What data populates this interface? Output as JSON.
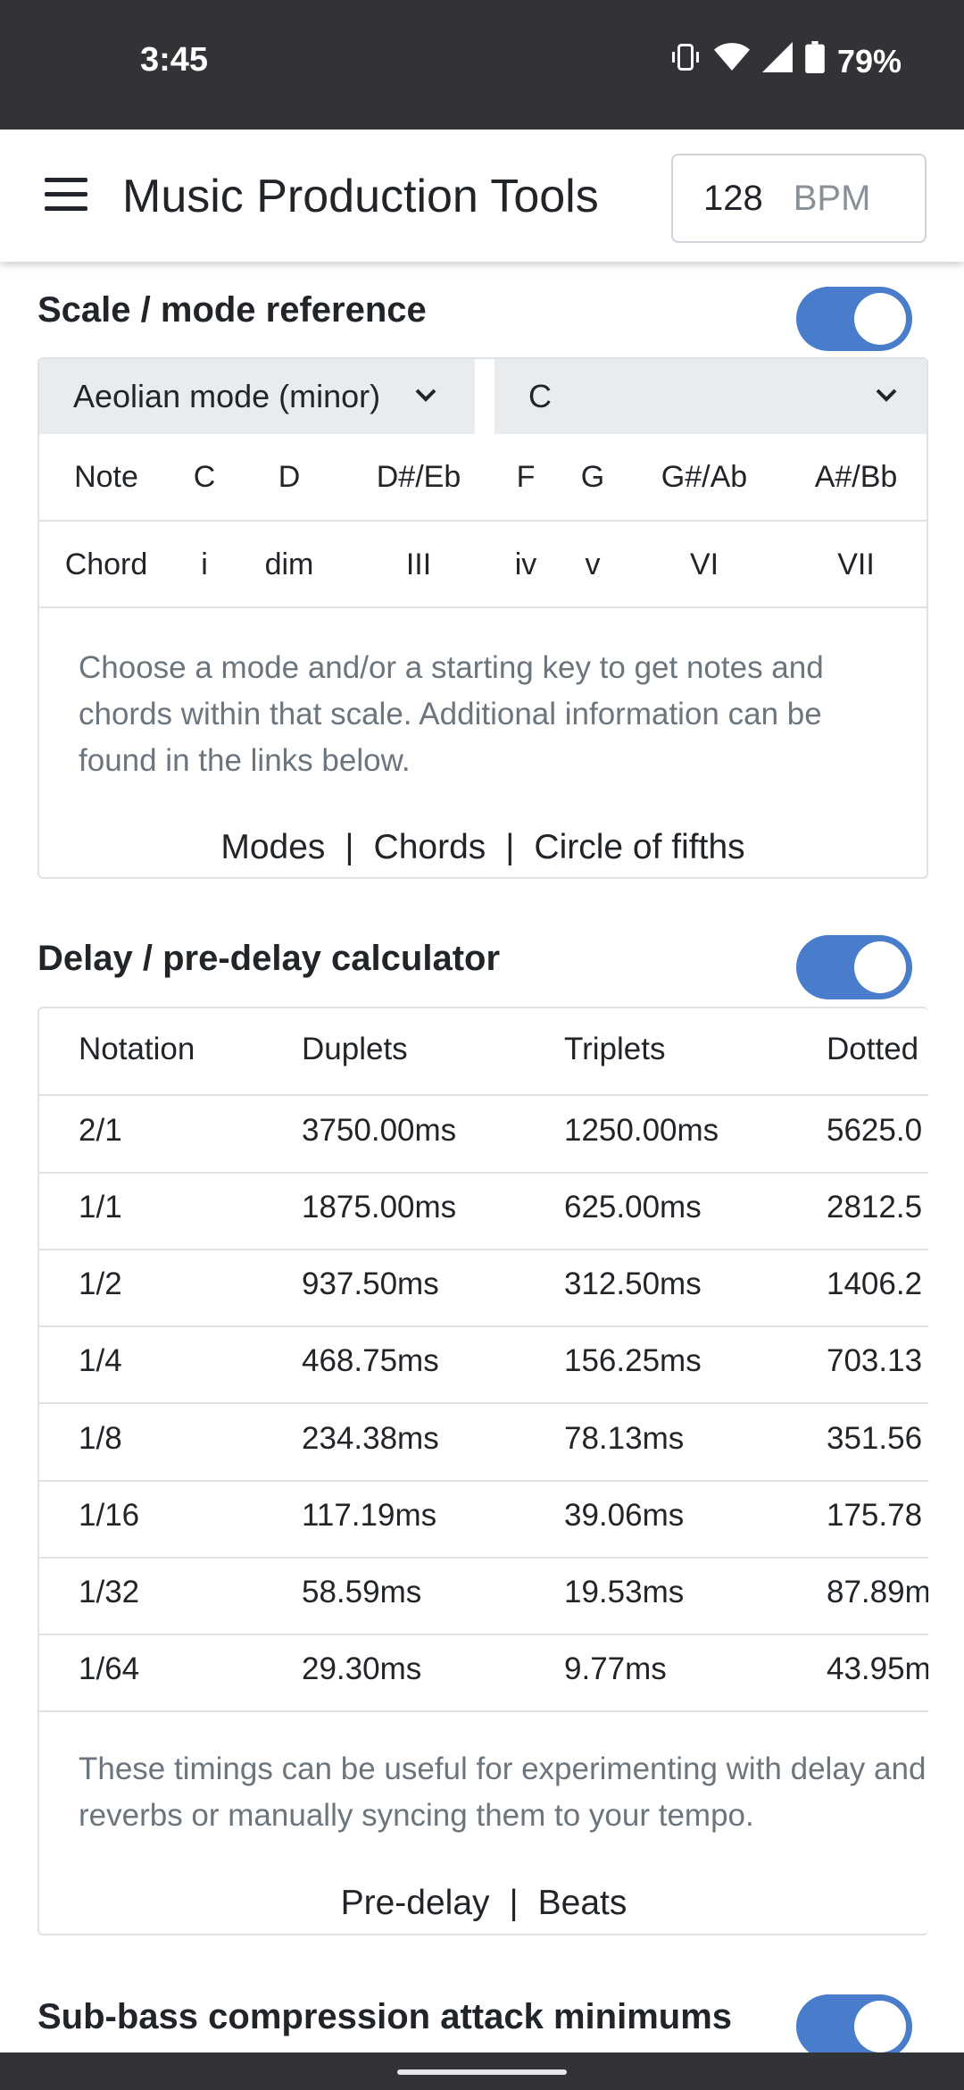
{
  "status_bar": {
    "time": "3:45",
    "battery": "79%"
  },
  "app_bar": {
    "title": "Music Production Tools",
    "bpm_value": "128",
    "bpm_unit": "BPM"
  },
  "scale_section": {
    "title": "Scale / mode reference",
    "toggle_on": true,
    "mode_select": "Aeolian mode (minor)",
    "key_select": "C",
    "notes": [
      "Note",
      "C",
      "D",
      "D#/Eb",
      "F",
      "G",
      "G#/Ab",
      "A#/Bb"
    ],
    "chords": [
      "Chord",
      "i",
      "dim",
      "III",
      "iv",
      "v",
      "VI",
      "VII"
    ],
    "description": "Choose a mode and/or a starting key to get notes and chords within that scale. Additional information can be found in the links below.",
    "links": [
      "Modes",
      "Chords",
      "Circle of fifths"
    ],
    "separator": "|"
  },
  "delay_section": {
    "title": "Delay / pre-delay calculator",
    "toggle_on": true,
    "headers": [
      "Notation",
      "Duplets",
      "Triplets",
      "Dotted"
    ],
    "rows": [
      [
        "2/1",
        "3750.00ms",
        "1250.00ms",
        "5625.0"
      ],
      [
        "1/1",
        "1875.00ms",
        "625.00ms",
        "2812.5"
      ],
      [
        "1/2",
        "937.50ms",
        "312.50ms",
        "1406.2"
      ],
      [
        "1/4",
        "468.75ms",
        "156.25ms",
        "703.13"
      ],
      [
        "1/8",
        "234.38ms",
        "78.13ms",
        "351.56"
      ],
      [
        "1/16",
        "117.19ms",
        "39.06ms",
        "175.78"
      ],
      [
        "1/32",
        "58.59ms",
        "19.53ms",
        "87.89m"
      ],
      [
        "1/64",
        "29.30ms",
        "9.77ms",
        "43.95m"
      ]
    ],
    "description": "These timings can be useful for experimenting with delay and reverbs or manually syncing them to your tempo.",
    "links": [
      "Pre-delay",
      "Beats"
    ],
    "separator": "|"
  },
  "subbass_section": {
    "title": "Sub-bass compression attack minimums",
    "toggle_on": true
  },
  "colors": {
    "accent": "#4a7ccc",
    "statusbar": "#323337",
    "select_bg": "#e9ecef"
  }
}
